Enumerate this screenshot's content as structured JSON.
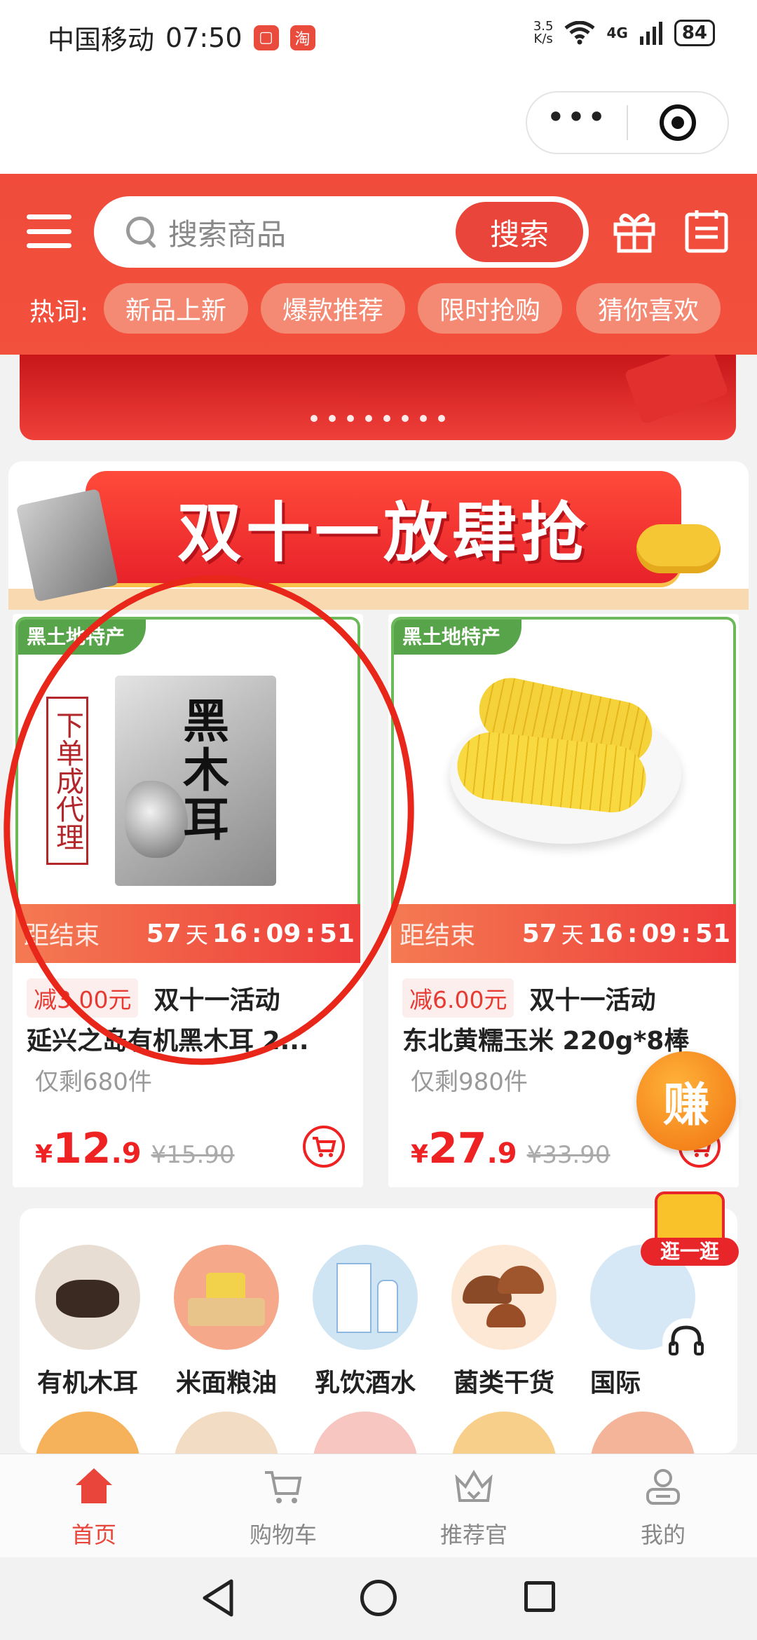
{
  "status_bar": {
    "carrier": "中国移动",
    "time": "07:50",
    "app_icon_1": "▢",
    "app_icon_2": "淘",
    "net_speed_value": "3.5",
    "net_speed_unit": "K/s",
    "network": "4G",
    "battery": "84"
  },
  "header": {
    "search_placeholder": "搜索商品",
    "search_button": "搜索",
    "hot_words_label": "热词:",
    "hot_words": [
      "新品上新",
      "爆款推荐",
      "限时抢购",
      "猜你喜欢"
    ]
  },
  "banner": {
    "dot_count": 8
  },
  "promo": {
    "title": "双十一放肆抢"
  },
  "products": [
    {
      "tag": "黑土地特产",
      "countdown_label": "距结束",
      "countdown_days": "57",
      "countdown_days_unit": "天",
      "countdown_h": "16",
      "countdown_m": "09",
      "countdown_s": "51",
      "discount": "减3.00元",
      "event": "双十一活动",
      "title": "延兴之岛有机黑木耳 2...",
      "stock": "仅剩680件",
      "price_yen": "¥",
      "price_int": "12",
      "price_dec": ".9",
      "price_original": "¥15.90",
      "image_text": "黑木耳",
      "image_side_text": "下单成代理"
    },
    {
      "tag": "黑土地特产",
      "countdown_label": "距结束",
      "countdown_days": "57",
      "countdown_days_unit": "天",
      "countdown_h": "16",
      "countdown_m": "09",
      "countdown_s": "51",
      "discount": "减6.00元",
      "event": "双十一活动",
      "title": "东北黄糯玉米 220g*8棒",
      "stock": "仅剩980件",
      "price_yen": "¥",
      "price_int": "27",
      "price_dec": ".9",
      "price_original": "¥33.90"
    }
  ],
  "floating": {
    "earn": "赚",
    "shop": "逛一逛"
  },
  "categories": [
    {
      "label": "有机木耳",
      "color": "#e8ddd2"
    },
    {
      "label": "米面粮油",
      "color": "#f6a88a"
    },
    {
      "label": "乳饮酒水",
      "color": "#cfe5f4"
    },
    {
      "label": "菌类干货",
      "color": "#fde8d6"
    },
    {
      "label": "国际",
      "color": "#d6e8f6"
    }
  ],
  "tabbar": {
    "items": [
      {
        "label": "首页",
        "icon": "home-icon",
        "active": true
      },
      {
        "label": "购物车",
        "icon": "cart-icon",
        "active": false
      },
      {
        "label": "推荐官",
        "icon": "crown-icon",
        "active": false
      },
      {
        "label": "我的",
        "icon": "user-icon",
        "active": false
      }
    ]
  },
  "colors": {
    "brand_red": "#f04b3b",
    "price_red": "#e22222",
    "tag_green": "#58a44a",
    "active_tab": "#e9453a"
  }
}
